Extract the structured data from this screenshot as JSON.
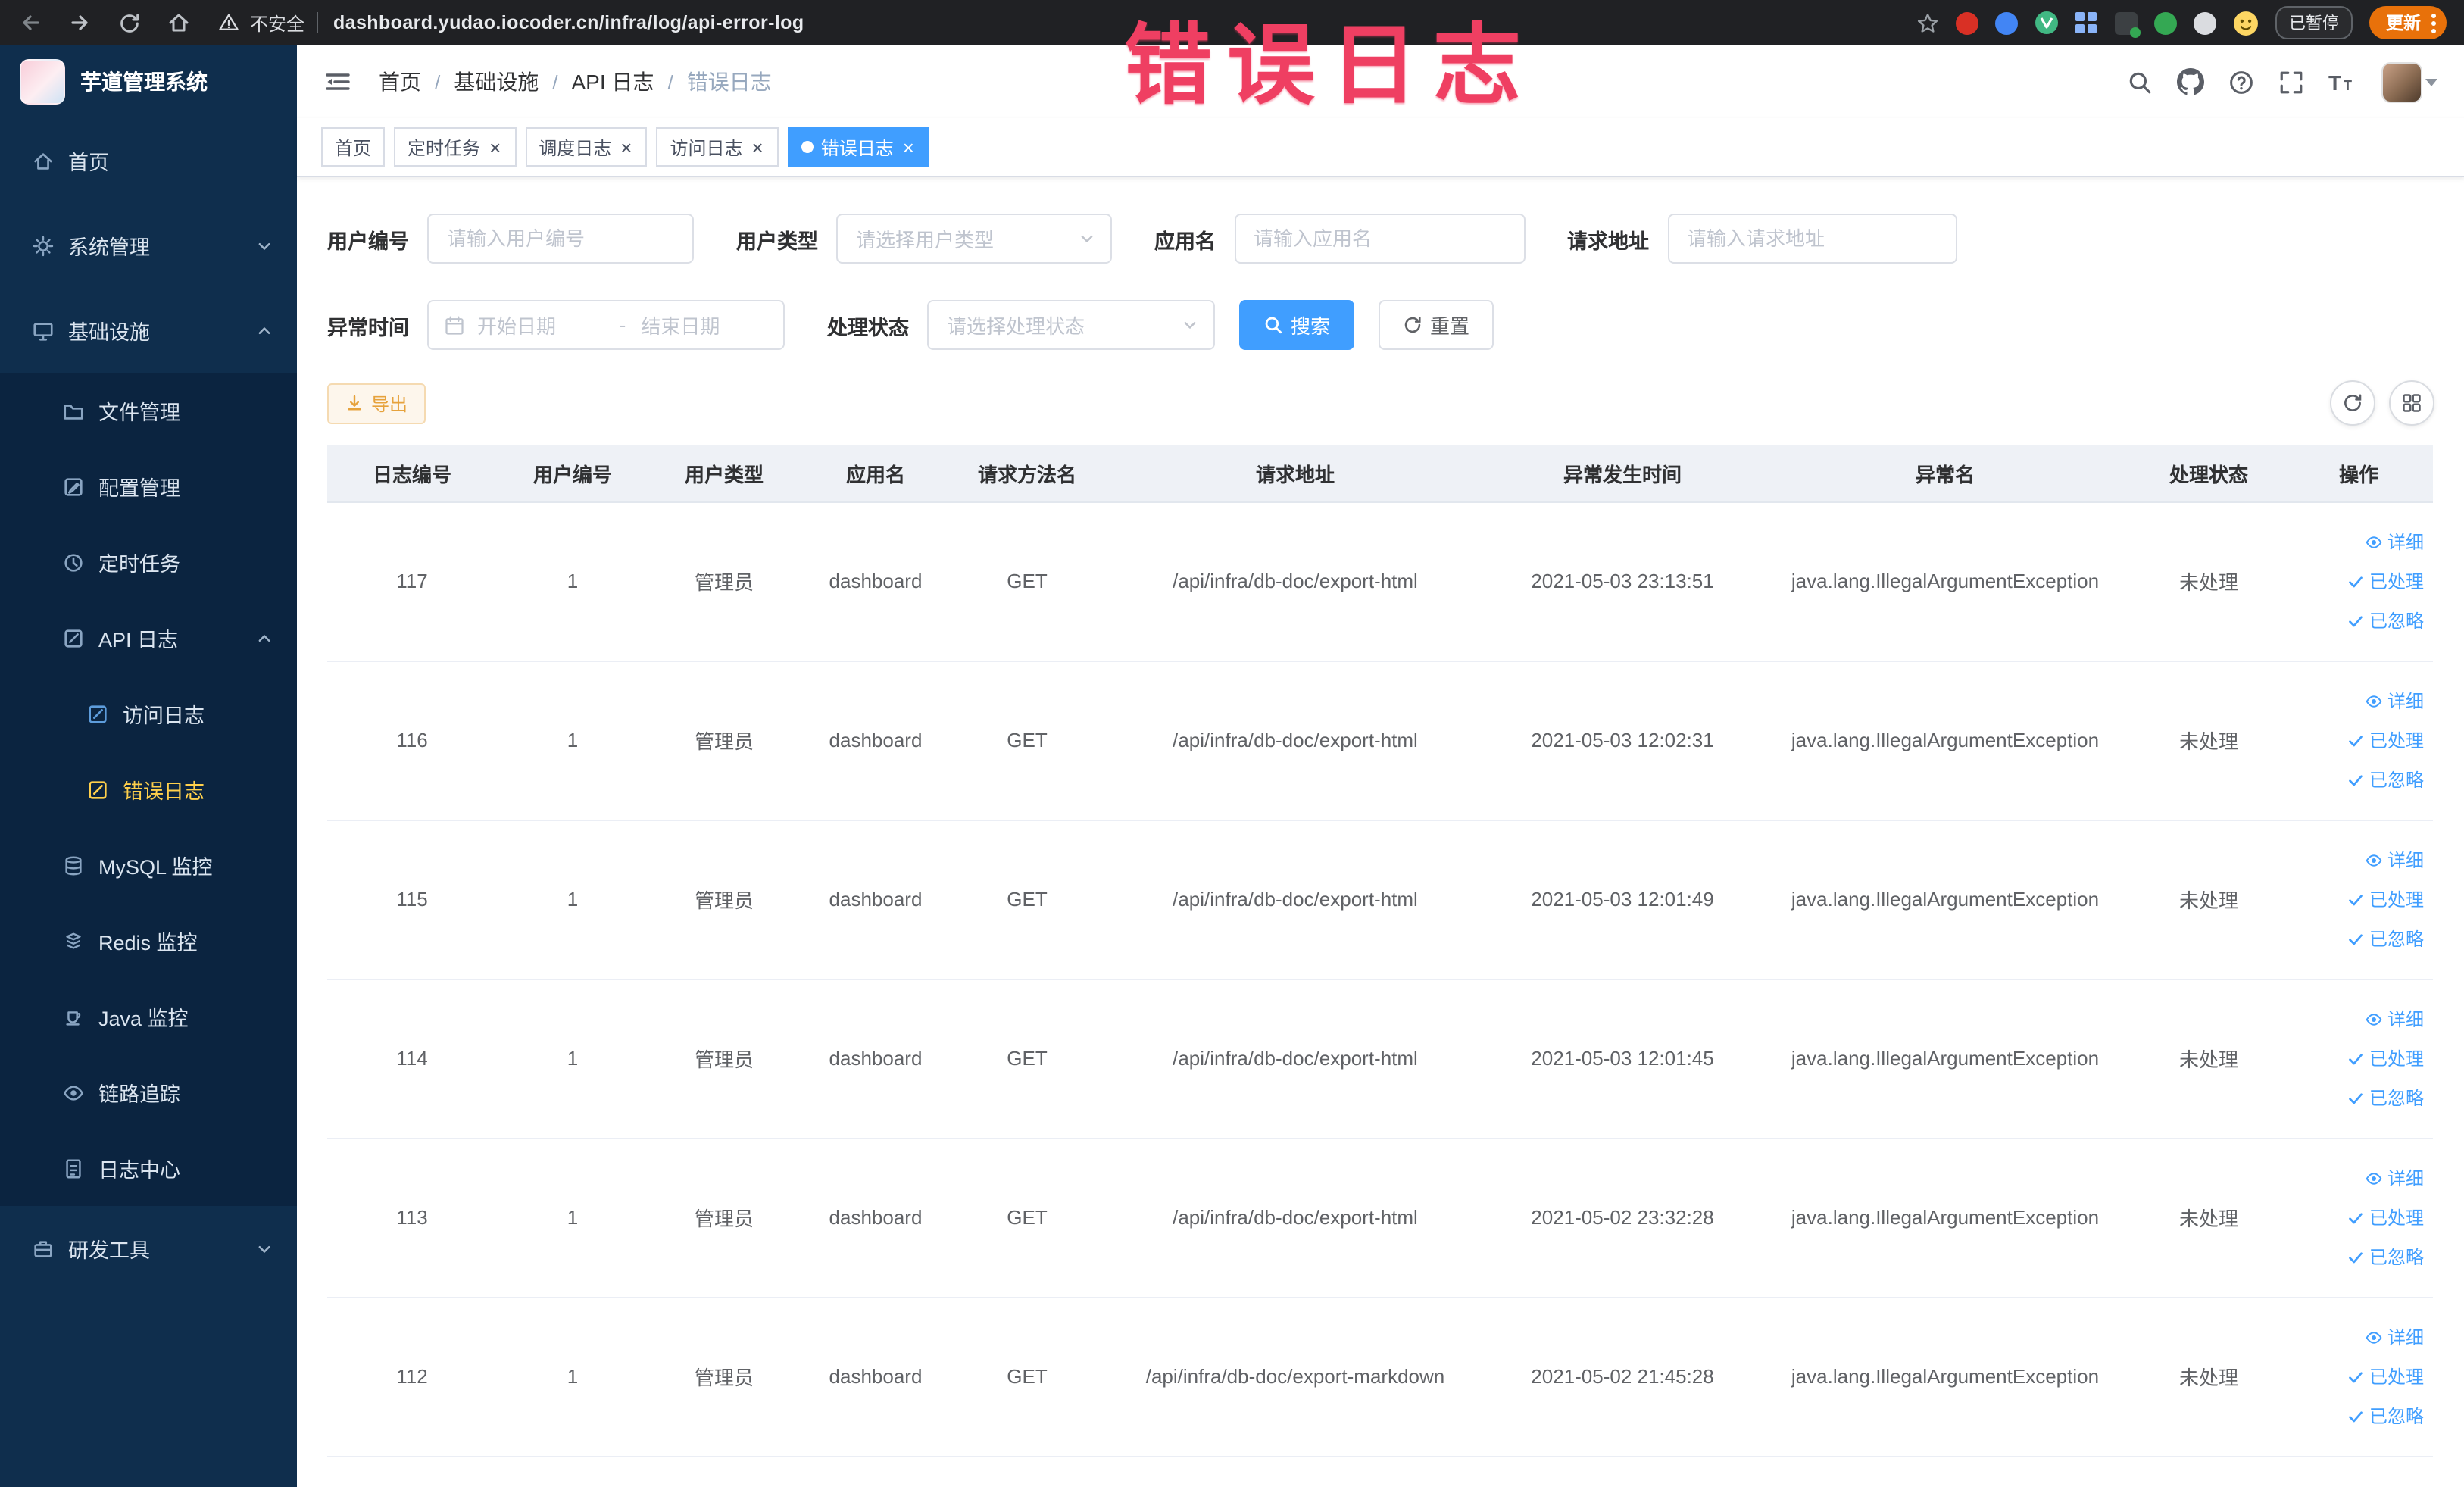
{
  "colors": {
    "accent": "#409eff",
    "sidebar_active": "#ffd04b",
    "warning": "#e6a23c",
    "annotation_red": "#ef3f62",
    "chrome_bg": "#202124",
    "sidebar_bg": "#0f2e4d",
    "submenu_bg": "#0b2440",
    "table_header_bg": "#eef1f6"
  },
  "annotation": {
    "text": "错误日志"
  },
  "browser": {
    "nav_icons": [
      "back-icon",
      "forward-icon",
      "reload-icon",
      "home-icon"
    ],
    "security_label": "不安全",
    "url": "dashboard.yudao.iocoder.cn/infra/log/api-error-log",
    "extension_icons": [
      "bookmark-star-icon",
      "red-extension-icon",
      "blue-extension-icon",
      "vue-devtools-icon",
      "grid-extension-icon",
      "on-badge-extension-icon",
      "green-extension-icon",
      "gray-extension-icon",
      "monkey-emoji-icon"
    ],
    "paused_badge": "已暂停",
    "update_button": "更新"
  },
  "sidebar": {
    "logo_title": "芋道管理系统",
    "items": [
      {
        "label": "首页",
        "icon": "home-icon"
      },
      {
        "label": "系统管理",
        "icon": "gear-icon",
        "arrow": "down"
      },
      {
        "label": "基础设施",
        "icon": "monitor-icon",
        "arrow": "up"
      },
      {
        "label": "文件管理",
        "icon": "folder-icon"
      },
      {
        "label": "配置管理",
        "icon": "config-icon"
      },
      {
        "label": "定时任务",
        "icon": "clock-icon"
      },
      {
        "label": "API 日志",
        "icon": "edit-square-icon",
        "arrow": "up"
      },
      {
        "label": "访问日志",
        "icon": "edit-square-icon"
      },
      {
        "label": "错误日志",
        "icon": "edit-square-icon",
        "active": true
      },
      {
        "label": "MySQL 监控",
        "icon": "database-icon"
      },
      {
        "label": "Redis 监控",
        "icon": "redis-icon"
      },
      {
        "label": "Java 监控",
        "icon": "cup-icon"
      },
      {
        "label": "链路追踪",
        "icon": "eye-icon"
      },
      {
        "label": "日志中心",
        "icon": "document-icon"
      },
      {
        "label": "研发工具",
        "icon": "briefcase-icon",
        "arrow": "down"
      }
    ]
  },
  "header": {
    "breadcrumb": [
      "首页",
      "基础设施",
      "API 日志",
      "错误日志"
    ],
    "action_icons": [
      "search-icon",
      "github-icon",
      "help-icon",
      "fullscreen-icon",
      "font-size-icon",
      "avatar",
      "chevron-down-icon"
    ]
  },
  "tabs": [
    {
      "label": "首页",
      "closable": false,
      "active": false
    },
    {
      "label": "定时任务",
      "closable": true,
      "active": false
    },
    {
      "label": "调度日志",
      "closable": true,
      "active": false
    },
    {
      "label": "访问日志",
      "closable": true,
      "active": false
    },
    {
      "label": "错误日志",
      "closable": true,
      "active": true
    }
  ],
  "filters": {
    "user_id": {
      "label": "用户编号",
      "placeholder": "请输入用户编号"
    },
    "user_type": {
      "label": "用户类型",
      "placeholder": "请选择用户类型"
    },
    "app_name": {
      "label": "应用名",
      "placeholder": "请输入应用名"
    },
    "request_url": {
      "label": "请求地址",
      "placeholder": "请输入请求地址"
    },
    "exception_time": {
      "label": "异常时间",
      "start_placeholder": "开始日期",
      "separator": "-",
      "end_placeholder": "结束日期"
    },
    "process_status": {
      "label": "处理状态",
      "placeholder": "请选择处理状态"
    },
    "search_button": "搜索",
    "reset_button": "重置"
  },
  "toolbar": {
    "export_button": "导出"
  },
  "table": {
    "headers": [
      "日志编号",
      "用户编号",
      "用户类型",
      "应用名",
      "请求方法名",
      "请求地址",
      "异常发生时间",
      "异常名",
      "处理状态",
      "操作"
    ],
    "row_actions": [
      "详细",
      "已处理",
      "已忽略"
    ],
    "rows": [
      {
        "id": "117",
        "user_id": "1",
        "user_type": "管理员",
        "app": "dashboard",
        "method": "GET",
        "url": "/api/infra/db-doc/export-html",
        "time": "2021-05-03 23:13:51",
        "exception": "java.lang.IllegalArgumentException",
        "status": "未处理"
      },
      {
        "id": "116",
        "user_id": "1",
        "user_type": "管理员",
        "app": "dashboard",
        "method": "GET",
        "url": "/api/infra/db-doc/export-html",
        "time": "2021-05-03 12:02:31",
        "exception": "java.lang.IllegalArgumentException",
        "status": "未处理"
      },
      {
        "id": "115",
        "user_id": "1",
        "user_type": "管理员",
        "app": "dashboard",
        "method": "GET",
        "url": "/api/infra/db-doc/export-html",
        "time": "2021-05-03 12:01:49",
        "exception": "java.lang.IllegalArgumentException",
        "status": "未处理"
      },
      {
        "id": "114",
        "user_id": "1",
        "user_type": "管理员",
        "app": "dashboard",
        "method": "GET",
        "url": "/api/infra/db-doc/export-html",
        "time": "2021-05-03 12:01:45",
        "exception": "java.lang.IllegalArgumentException",
        "status": "未处理"
      },
      {
        "id": "113",
        "user_id": "1",
        "user_type": "管理员",
        "app": "dashboard",
        "method": "GET",
        "url": "/api/infra/db-doc/export-html",
        "time": "2021-05-02 23:32:28",
        "exception": "java.lang.IllegalArgumentException",
        "status": "未处理"
      },
      {
        "id": "112",
        "user_id": "1",
        "user_type": "管理员",
        "app": "dashboard",
        "method": "GET",
        "url": "/api/infra/db-doc/export-markdown",
        "time": "2021-05-02 21:45:28",
        "exception": "java.lang.IllegalArgumentException",
        "status": "未处理"
      }
    ]
  }
}
